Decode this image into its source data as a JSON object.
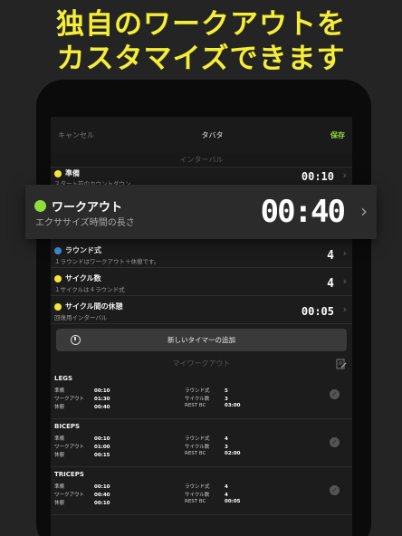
{
  "headline": [
    "独自のワークアウトを",
    "カスタマイズできます"
  ],
  "nav": {
    "cancel": "キャンセル",
    "title": "タバタ",
    "save": "保存"
  },
  "interval_header": "インターバル",
  "rows": [
    {
      "title": "準備",
      "sub": "スタート前のカウントダウン",
      "value": "00:10",
      "dot_color": "#f5e63a"
    },
    {
      "title": "ワークアウト",
      "sub": "エクササイズ時間の長さ",
      "value": "00:40",
      "dot_color": "#8fdd3c"
    },
    {
      "title": "ラウンド式",
      "sub": "１ラウンドはワークアウト＋休憩です。",
      "value": "4",
      "dot_color": "#3d8fd6"
    },
    {
      "title": "サイクル数",
      "sub": "１サイクルは４ラウンド式",
      "value": "4",
      "dot_color": "#f5e63a"
    },
    {
      "title": "サイクル間の休憩",
      "sub": "回復用インターバル",
      "value": "00:05",
      "dot_color": "#f5e63a"
    }
  ],
  "add_timer_label": "新しいタイマーの追加",
  "my_workouts_header": "マイワークアウト",
  "workouts": [
    {
      "name": "LEGS",
      "left": [
        {
          "k": "準備",
          "v": "00:10"
        },
        {
          "k": "ワークアウト",
          "v": "01:30"
        },
        {
          "k": "休憩",
          "v": "00:40"
        }
      ],
      "right": [
        {
          "k": "ラウンド式",
          "v": "5"
        },
        {
          "k": "サイクル数",
          "v": "3"
        },
        {
          "k": "REST BC",
          "v": "03:00"
        }
      ]
    },
    {
      "name": "BICEPS",
      "left": [
        {
          "k": "準備",
          "v": "00:10"
        },
        {
          "k": "ワークアウト",
          "v": "01:00"
        },
        {
          "k": "休憩",
          "v": "00:15"
        }
      ],
      "right": [
        {
          "k": "ラウンド式",
          "v": "4"
        },
        {
          "k": "サイクル数",
          "v": "3"
        },
        {
          "k": "REST BC",
          "v": "02:00"
        }
      ]
    },
    {
      "name": "TRICEPS",
      "left": [
        {
          "k": "準備",
          "v": "00:10"
        },
        {
          "k": "ワークアウト",
          "v": "00:40"
        },
        {
          "k": "休憩",
          "v": "00:10"
        }
      ],
      "right": [
        {
          "k": "ラウンド式",
          "v": "4"
        },
        {
          "k": "サイクル数",
          "v": "4"
        },
        {
          "k": "REST BC",
          "v": "00:05"
        }
      ]
    }
  ],
  "colors": {
    "headline": "#f5ee35",
    "accent_green": "#8fdd3c",
    "background": "#242424"
  }
}
